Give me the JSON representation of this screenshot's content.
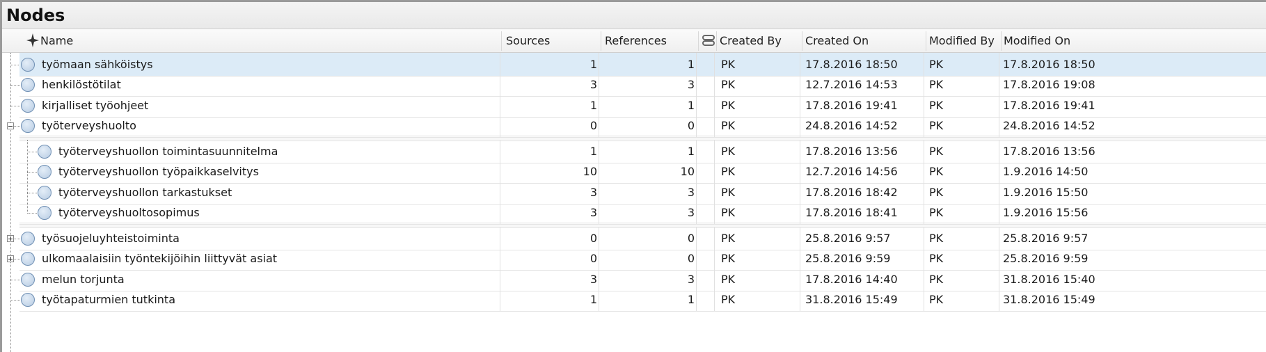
{
  "panel": {
    "title": "Nodes"
  },
  "header": {
    "name": "Name",
    "sources": "Sources",
    "references": "References",
    "created_by": "Created By",
    "created_on": "Created On",
    "modified_by": "Modified By",
    "modified_on": "Modified On",
    "pin_icon": "pin-icon",
    "link_icon": "chain-link-icon"
  },
  "rows": [
    {
      "name": "työmaan sähköistys",
      "sources": "1",
      "references": "1",
      "created_by": "PK",
      "created_on": "17.8.2016 18:50",
      "modified_by": "PK",
      "modified_on": "17.8.2016 18:50",
      "level": 0,
      "selected": true
    },
    {
      "name": "henkilöstötilat",
      "sources": "3",
      "references": "3",
      "created_by": "PK",
      "created_on": "12.7.2016 14:53",
      "modified_by": "PK",
      "modified_on": "17.8.2016 19:08",
      "level": 0
    },
    {
      "name": "kirjalliset työohjeet",
      "sources": "1",
      "references": "1",
      "created_by": "PK",
      "created_on": "17.8.2016 19:41",
      "modified_by": "PK",
      "modified_on": "17.8.2016 19:41",
      "level": 0
    },
    {
      "name": "työterveyshuolto",
      "sources": "0",
      "references": "0",
      "created_by": "PK",
      "created_on": "24.8.2016 14:52",
      "modified_by": "PK",
      "modified_on": "24.8.2016 14:52",
      "level": 0,
      "expander": "minus"
    },
    {
      "name": "työterveyshuollon toimintasuunnitelma",
      "sources": "1",
      "references": "1",
      "created_by": "PK",
      "created_on": "17.8.2016 13:56",
      "modified_by": "PK",
      "modified_on": "17.8.2016 13:56",
      "level": 1
    },
    {
      "name": "työterveyshuollon työpaikkaselvitys",
      "sources": "10",
      "references": "10",
      "created_by": "PK",
      "created_on": "12.7.2016 14:56",
      "modified_by": "PK",
      "modified_on": "1.9.2016 14:50",
      "level": 1
    },
    {
      "name": "työterveyshuollon tarkastukset",
      "sources": "3",
      "references": "3",
      "created_by": "PK",
      "created_on": "17.8.2016 18:42",
      "modified_by": "PK",
      "modified_on": "1.9.2016 15:50",
      "level": 1
    },
    {
      "name": "työterveyshuoltosopimus",
      "sources": "3",
      "references": "3",
      "created_by": "PK",
      "created_on": "17.8.2016 18:41",
      "modified_by": "PK",
      "modified_on": "1.9.2016 15:56",
      "level": 1
    },
    {
      "name": "työsuojeluyhteistoiminta",
      "sources": "0",
      "references": "0",
      "created_by": "PK",
      "created_on": "25.8.2016 9:57",
      "modified_by": "PK",
      "modified_on": "25.8.2016 9:57",
      "level": 0,
      "expander": "plus"
    },
    {
      "name": "ulkomaalaisiin työntekijöihin liittyvät asiat",
      "sources": "0",
      "references": "0",
      "created_by": "PK",
      "created_on": "25.8.2016 9:59",
      "modified_by": "PK",
      "modified_on": "25.8.2016 9:59",
      "level": 0,
      "expander": "plus"
    },
    {
      "name": "melun torjunta",
      "sources": "3",
      "references": "3",
      "created_by": "PK",
      "created_on": "17.8.2016 14:40",
      "modified_by": "PK",
      "modified_on": "31.8.2016 15:40",
      "level": 0
    },
    {
      "name": "työtapaturmien tutkinta",
      "sources": "1",
      "references": "1",
      "created_by": "PK",
      "created_on": "31.8.2016 15:49",
      "modified_by": "PK",
      "modified_on": "31.8.2016 15:49",
      "level": 0
    }
  ]
}
